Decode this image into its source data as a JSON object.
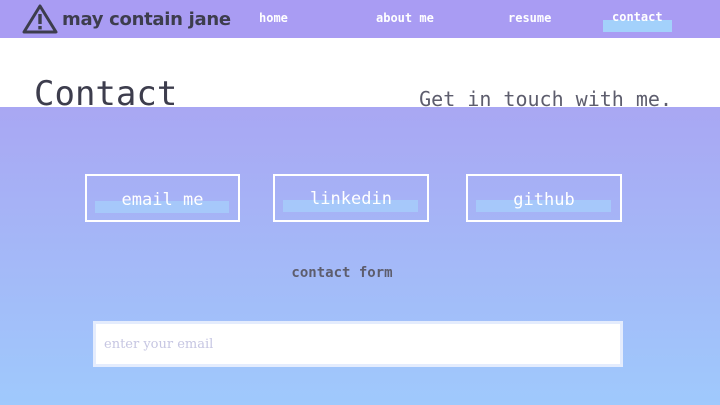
{
  "brand": {
    "name": "may contain jane",
    "icon": "warning-triangle-icon"
  },
  "nav": {
    "home": "home",
    "about": "about me",
    "resume": "resume",
    "contact": "contact",
    "active": "contact"
  },
  "header": {
    "title": "Contact",
    "tagline": "Get in touch with me."
  },
  "buttons": {
    "email": "email me",
    "linkedin": "linkedin",
    "github": "github"
  },
  "contact_form": {
    "link_label": "contact form",
    "email_placeholder": "enter your email",
    "email_value": ""
  },
  "colors": {
    "nav_background": "#a99cf3",
    "gradient_top": "#a9a7f3",
    "gradient_bottom": "#9fc9fc",
    "highlight": "#a3d1fb",
    "text_dark": "#3d3d4d"
  }
}
